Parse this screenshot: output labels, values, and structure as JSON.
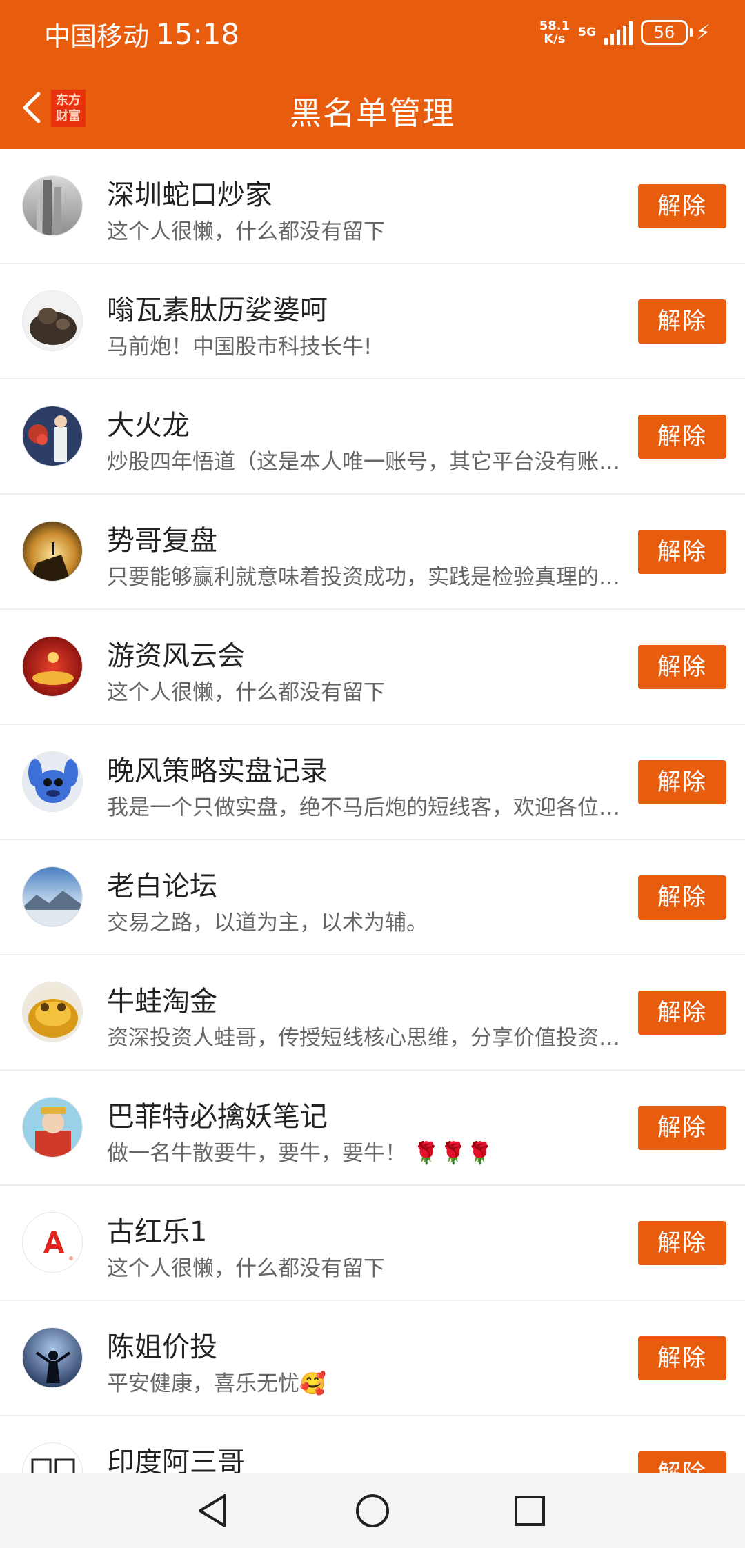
{
  "status_bar": {
    "carrier": "中国移动",
    "time": "15:18",
    "net_speed_value": "58.1",
    "net_speed_unit": "K/s",
    "network": "5G",
    "battery": "56"
  },
  "header": {
    "back_icon": "chevron-left-icon",
    "logo_text_line1": "东方",
    "logo_text_line2": "财富",
    "title": "黑名单管理"
  },
  "colors": {
    "accent": "#e85c0d"
  },
  "blocked_users": [
    {
      "name": "深圳蛇口炒家",
      "bio": "这个人很懒，什么都没有留下",
      "action": "解除"
    },
    {
      "name": "嗡瓦素肽历娑婆呵",
      "bio": "马前炮！中国股市科技长牛!",
      "action": "解除"
    },
    {
      "name": "大火龙",
      "bio": "炒股四年悟道（这是本人唯一账号，其它平台没有账号）",
      "action": "解除"
    },
    {
      "name": "势哥复盘",
      "bio": "只要能够赢利就意味着投资成功，实践是检验真理的唯一标准",
      "action": "解除"
    },
    {
      "name": "游资风云会",
      "bio": "这个人很懒，什么都没有留下",
      "action": "解除"
    },
    {
      "name": "晚风策略实盘记录",
      "bio": "我是一个只做实盘，绝不马后炮的短线客，欢迎各位朋友",
      "action": "解除"
    },
    {
      "name": "老白论坛",
      "bio": "交易之路，以道为主，以术为辅。",
      "action": "解除"
    },
    {
      "name": "牛蛙淘金",
      "bio": "资深投资人蛙哥，传授短线核心思维，分享价值投资理念",
      "action": "解除"
    },
    {
      "name": "巴菲特必擒妖笔记",
      "bio": "做一名牛散要牛，要牛，要牛！ 🌹🌹🌹",
      "action": "解除"
    },
    {
      "name": "古红乐1",
      "bio": "这个人很懒，什么都没有留下",
      "action": "解除"
    },
    {
      "name": "陈姐价投",
      "bio": "平安健康，喜乐无忧🥰",
      "action": "解除"
    },
    {
      "name": "印度阿三哥",
      "bio": "",
      "action": "解除"
    }
  ],
  "system_nav": {
    "back": "triangle-back-icon",
    "home": "circle-home-icon",
    "recents": "square-recents-icon"
  }
}
